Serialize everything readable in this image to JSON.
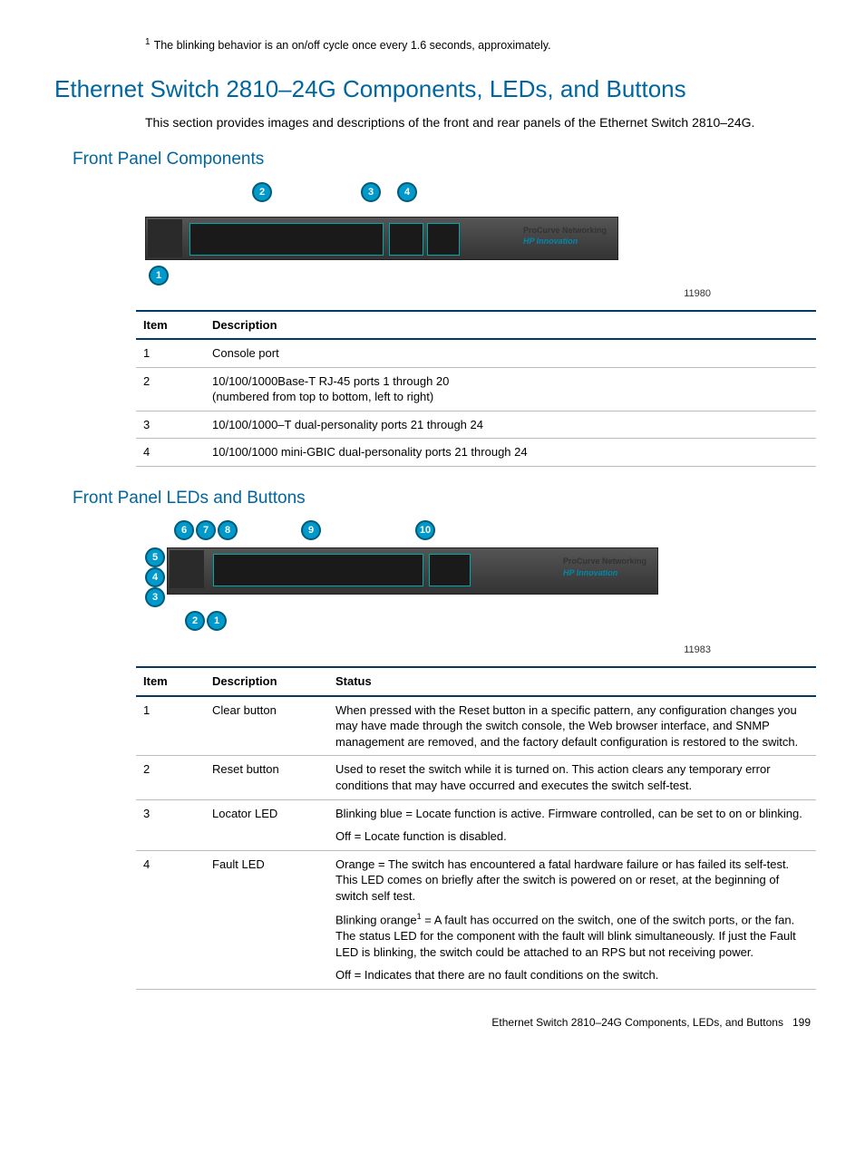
{
  "footnote": "The blinking behavior is an on/off cycle once every 1.6 seconds, approximately.",
  "title": "Ethernet Switch 2810–24G Components, LEDs, and Buttons",
  "intro": "This section provides images and descriptions of the front and rear panels of the Ethernet Switch 2810–24G.",
  "sections": {
    "fpc": {
      "heading": "Front Panel Components",
      "figId": "11980",
      "brand1": "ProCurve Networking",
      "brand2": "HP Innovation",
      "table": {
        "headers": [
          "Item",
          "Description"
        ],
        "rows": [
          {
            "item": "1",
            "desc": "Console port"
          },
          {
            "item": "2",
            "desc": "10/100/1000Base-T RJ-45 ports 1 through 20\n(numbered from top to bottom, left to right)"
          },
          {
            "item": "3",
            "desc": "10/100/1000–T dual-personality ports 21 through 24"
          },
          {
            "item": "4",
            "desc": "10/100/1000 mini-GBIC dual-personality ports 21 through 24"
          }
        ]
      }
    },
    "fplb": {
      "heading": "Front Panel LEDs and Buttons",
      "figId": "11983",
      "brand1": "ProCurve Networking",
      "brand2": "HP Innovation",
      "table": {
        "headers": [
          "Item",
          "Description",
          "Status"
        ],
        "rows": [
          {
            "item": "1",
            "desc": "Clear button",
            "status": [
              "When pressed with the Reset button in a specific pattern, any configuration changes you may have made through the switch console, the Web browser interface, and SNMP management are removed, and the factory default configuration is restored to the switch."
            ]
          },
          {
            "item": "2",
            "desc": "Reset button",
            "status": [
              "Used to reset the switch while it is turned on. This action clears any temporary error conditions that may have occurred and executes the switch self-test."
            ]
          },
          {
            "item": "3",
            "desc": "Locator LED",
            "status": [
              "Blinking blue = Locate function is active. Firmware controlled, can be set to on or blinking.",
              "Off = Locate function is disabled."
            ]
          },
          {
            "item": "4",
            "desc": "Fault LED",
            "status": [
              "Orange = The switch has encountered a fatal hardware failure or has failed its self-test. This LED comes on briefly after the switch is powered on or reset, at the beginning of switch self test.",
              "Blinking orange¹ = A fault has occurred on the switch, one of the switch ports, or the fan. The status LED for the component with the fault will blink simultaneously. If just the Fault LED is blinking, the switch could be attached to an RPS but not receiving power.",
              "Off = Indicates that there are no fault conditions on the switch."
            ]
          }
        ]
      }
    }
  },
  "footer": {
    "text": "Ethernet Switch 2810–24G Components, LEDs, and Buttons",
    "page": "199"
  }
}
